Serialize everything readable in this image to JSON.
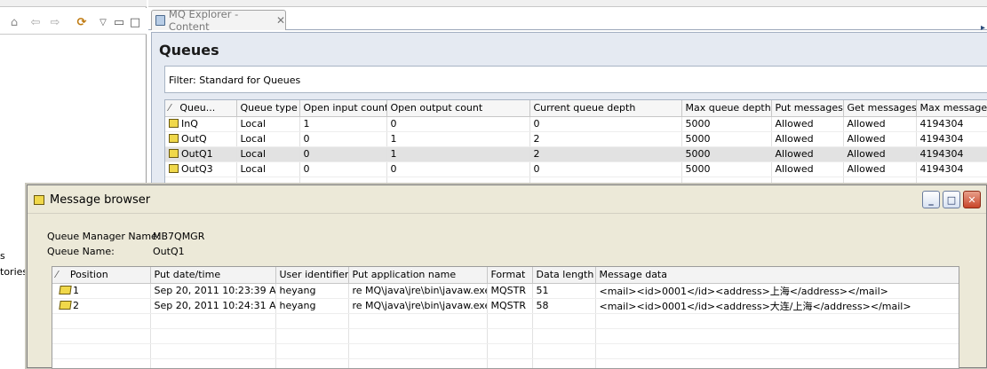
{
  "left_pane": {
    "cut_text_1": "s",
    "cut_text_2": "tories"
  },
  "content_tab": {
    "title": "MQ Explorer - Content",
    "close": "✕"
  },
  "queues_panel": {
    "title": "Queues",
    "filter_text": "Filter:  Standard for Queues",
    "columns": [
      "Queu...",
      "Queue type",
      "Open input count",
      "Open output count",
      "Current queue depth",
      "Max queue depth",
      "Put messages",
      "Get messages",
      "Max message le"
    ],
    "rows": [
      {
        "name": "InQ",
        "type": "Local",
        "open_input": "1",
        "open_output": "0",
        "depth": "0",
        "max_depth": "5000",
        "put": "Allowed",
        "get": "Allowed",
        "max_msg": "4194304"
      },
      {
        "name": "OutQ",
        "type": "Local",
        "open_input": "0",
        "open_output": "1",
        "depth": "2",
        "max_depth": "5000",
        "put": "Allowed",
        "get": "Allowed",
        "max_msg": "4194304"
      },
      {
        "name": "OutQ1",
        "type": "Local",
        "open_input": "0",
        "open_output": "1",
        "depth": "2",
        "max_depth": "5000",
        "put": "Allowed",
        "get": "Allowed",
        "max_msg": "4194304"
      },
      {
        "name": "OutQ3",
        "type": "Local",
        "open_input": "0",
        "open_output": "0",
        "depth": "0",
        "max_depth": "5000",
        "put": "Allowed",
        "get": "Allowed",
        "max_msg": "4194304"
      }
    ]
  },
  "message_browser": {
    "title": "Message browser",
    "qm_label": "Queue Manager Name:",
    "qm_value": "MB7QMGR",
    "qn_label": "Queue Name:",
    "qn_value": "OutQ1",
    "columns": [
      "Position",
      "Put date/time",
      "User identifier",
      "Put application name",
      "Format",
      "Data length",
      "Message data"
    ],
    "rows": [
      {
        "position": "1",
        "put_time": "Sep 20, 2011 10:23:39 AM",
        "user": "heyang",
        "app": "re MQ\\java\\jre\\bin\\javaw.exe",
        "format": "MQSTR",
        "length": "51",
        "data": "<mail><id>0001</id><address>上海</address></mail>"
      },
      {
        "position": "2",
        "put_time": "Sep 20, 2011 10:24:31 AM",
        "user": "heyang",
        "app": "re MQ\\java\\jre\\bin\\javaw.exe",
        "format": "MQSTR",
        "length": "58",
        "data": "<mail><id>0001</id><address>大连/上海</address></mail>"
      }
    ]
  },
  "colors": {
    "panel_bg": "#e5eaf2",
    "dialog_bg": "#ece9d8",
    "selected_row": "#e2e2e2"
  }
}
